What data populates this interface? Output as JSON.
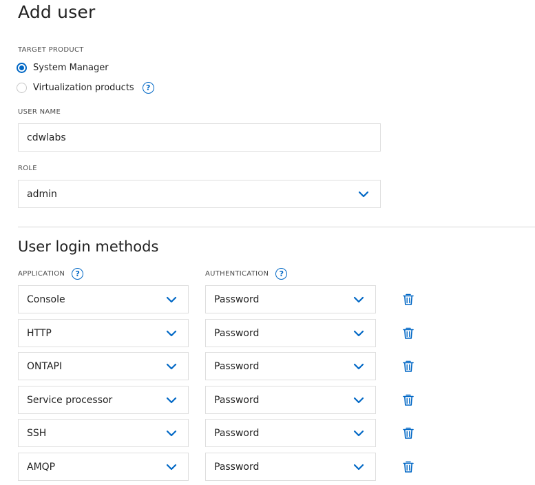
{
  "page": {
    "title": "Add user"
  },
  "target_product": {
    "label": "TARGET PRODUCT",
    "options": [
      {
        "label": "System Manager",
        "selected": true
      },
      {
        "label": "Virtualization products",
        "selected": false,
        "help_icon": "question-circle-icon"
      }
    ]
  },
  "user_name": {
    "label": "USER NAME",
    "value": "cdwlabs"
  },
  "role": {
    "label": "ROLE",
    "value": "admin"
  },
  "login_methods": {
    "title": "User login methods",
    "application_header": "APPLICATION",
    "authentication_header": "AUTHENTICATION",
    "rows": [
      {
        "application": "Console",
        "authentication": "Password"
      },
      {
        "application": "HTTP",
        "authentication": "Password"
      },
      {
        "application": "ONTAPI",
        "authentication": "Password"
      },
      {
        "application": "Service processor",
        "authentication": "Password"
      },
      {
        "application": "SSH",
        "authentication": "Password"
      },
      {
        "application": "AMQP",
        "authentication": "Password"
      }
    ]
  },
  "colors": {
    "accent": "#0067c5",
    "border": "#dedede",
    "divider": "#d5d5d5"
  }
}
